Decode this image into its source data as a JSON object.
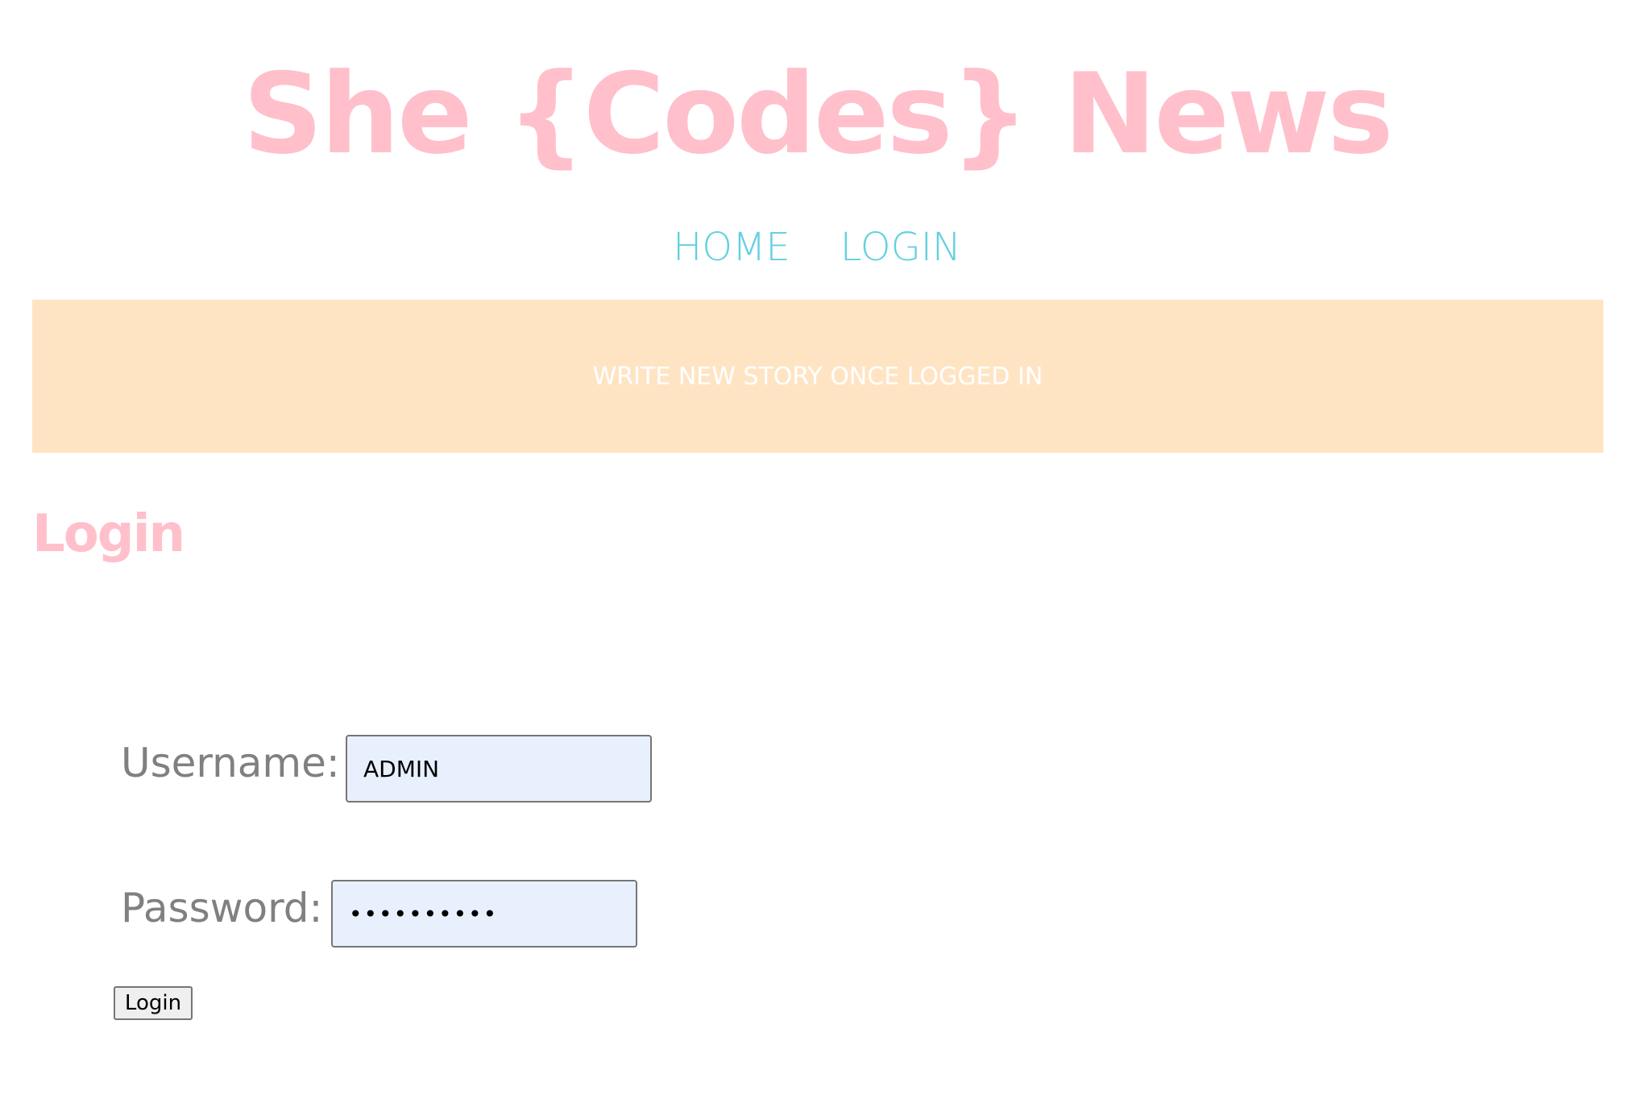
{
  "header": {
    "site_title": "She {Codes} News"
  },
  "nav": {
    "items": [
      {
        "label": "HOME"
      },
      {
        "label": "LOGIN"
      }
    ]
  },
  "banner": {
    "text": "WRITE NEW STORY ONCE LOGGED IN"
  },
  "main": {
    "heading": "Login",
    "form": {
      "username_label": "Username:",
      "username_value": "ADMIN",
      "password_label": "Password:",
      "password_value": "••••••••••",
      "submit_label": "Login"
    }
  },
  "colors": {
    "title_pink": "#ffc0cb",
    "nav_cyan": "#63d0e1",
    "banner_bg": "#ffe4c4",
    "label_gray": "#808080",
    "input_bg": "#e8f0fe"
  }
}
